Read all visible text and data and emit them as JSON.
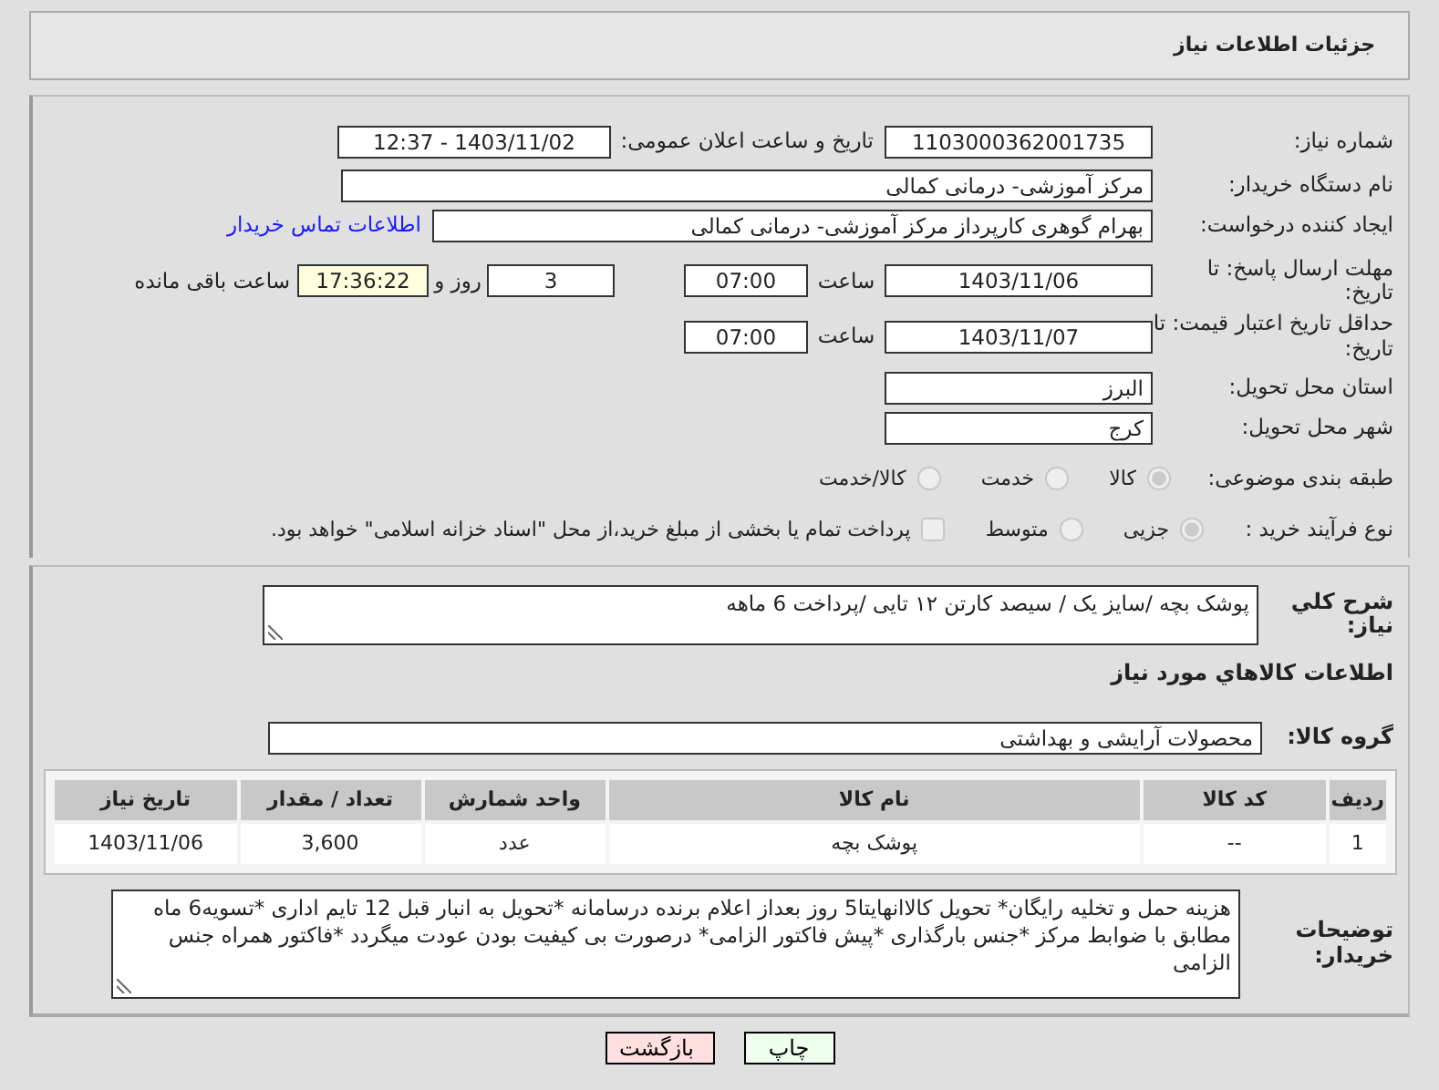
{
  "header": {
    "title": "جزئیات اطلاعات نیاز"
  },
  "need_number": {
    "label": "شماره نیاز:",
    "value": "1103000362001735"
  },
  "announce": {
    "label": "تاریخ و ساعت اعلان عمومی:",
    "value": "1403/11/02 - 12:37"
  },
  "buyer_org": {
    "label": "نام دستگاه خریدار:",
    "value": "مرکز آموزشی- درمانی کمالی"
  },
  "requester": {
    "label": "ایجاد کننده درخواست:",
    "value": "بهرام گوهری کارپرداز مرکز آموزشی- درمانی کمالی",
    "link": "اطلاعات تماس خریدار"
  },
  "reply_deadline": {
    "label": "مهلت ارسال پاسخ: تا تاریخ:",
    "date": "1403/11/06",
    "time_label": "ساعت",
    "time": "07:00",
    "days": "3",
    "days_label": "روز و",
    "remaining": "17:36:22",
    "remaining_label": "ساعت باقی مانده"
  },
  "price_validity": {
    "label": "حداقل تاریخ اعتبار قیمت: تا تاریخ:",
    "date": "1403/11/07",
    "time_label": "ساعت",
    "time": "07:00"
  },
  "province": {
    "label": "استان محل تحویل:",
    "value": "البرز"
  },
  "city": {
    "label": "شهر محل تحویل:",
    "value": "کرج"
  },
  "category": {
    "label": "طبقه بندی موضوعی:",
    "options": [
      {
        "label": "کالا",
        "selected": true
      },
      {
        "label": "خدمت",
        "selected": false
      },
      {
        "label": "کالا/خدمت",
        "selected": false
      }
    ]
  },
  "purchase_type": {
    "label": "نوع فرآیند خرید :",
    "options": [
      {
        "label": "جزیی",
        "selected": true
      },
      {
        "label": "متوسط",
        "selected": false
      }
    ],
    "payment": {
      "label": "پرداخت تمام یا بخشی از مبلغ خرید،از محل \"اسناد خزانه اسلامی\" خواهد بود.",
      "checked": false
    }
  },
  "description": {
    "label": "شرح كلي نياز:",
    "value": "پوشک بچه /سایز یک / سیصد کارتن ۱۲ تایی /پرداخت 6 ماهه"
  },
  "goods_heading": "اطلاعات كالاهاي مورد نياز",
  "goods_group": {
    "label": "گروه کالا:",
    "value": "محصولات آرایشی و بهداشتی"
  },
  "table": {
    "columns": [
      "ردیف",
      "کد کالا",
      "نام کالا",
      "واحد شمارش",
      "تعداد / مقدار",
      "تاریخ نیاز"
    ],
    "rows": [
      [
        "1",
        "--",
        "پوشک بچه",
        "عدد",
        "3,600",
        "1403/11/06"
      ]
    ]
  },
  "buyer_notes": {
    "label": "توضیحات خریدار:",
    "value": "هزینه حمل و تخلیه رایگان* تحویل کالاانهایتا5 روز بعداز اعلام برنده درسامانه *تحویل به انبار قبل 12 تایم اداری *تسویه6 ماه مطابق با ضوابط مرکز *جنس بارگذاری *پیش فاکتور الزامی* درصورت بی کیفیت بودن عودت میگردد *فاکتور همراه جنس الزامی"
  },
  "buttons": [
    {
      "label": "چاپ",
      "kind": "print"
    },
    {
      "label": "بازگشت",
      "kind": "back"
    }
  ]
}
